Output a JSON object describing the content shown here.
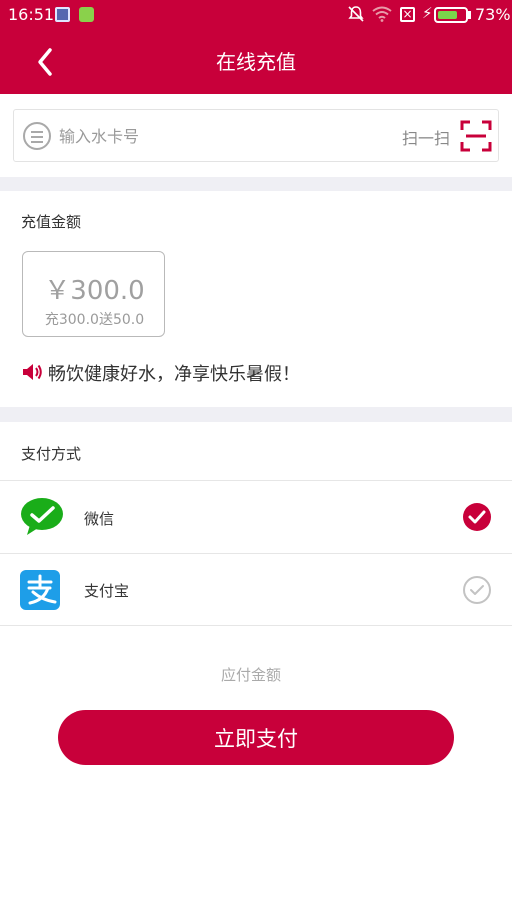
{
  "status_bar": {
    "time": "16:51",
    "battery_percent": "73%",
    "battery_level": 0.73
  },
  "header": {
    "title": "在线充值",
    "back_icon": "chevron-left-icon"
  },
  "card_search": {
    "placeholder": "输入水卡号",
    "scan_label": "扫一扫"
  },
  "recharge": {
    "title": "充值金额",
    "options": [
      {
        "amount": "￥300.0",
        "bonus": "充300.0送50.0"
      }
    ]
  },
  "promo": {
    "text": "畅饮健康好水，净享快乐暑假！"
  },
  "payment": {
    "title": "支付方式",
    "methods": [
      {
        "label": "微信",
        "selected": true
      },
      {
        "label": "支付宝",
        "selected": false
      }
    ]
  },
  "footer": {
    "due_label": "应付金额",
    "pay_button": "立即支付"
  },
  "colors": {
    "brand": "#c8003a",
    "wechat": "#1aad19",
    "alipay": "#1e9ee8"
  }
}
